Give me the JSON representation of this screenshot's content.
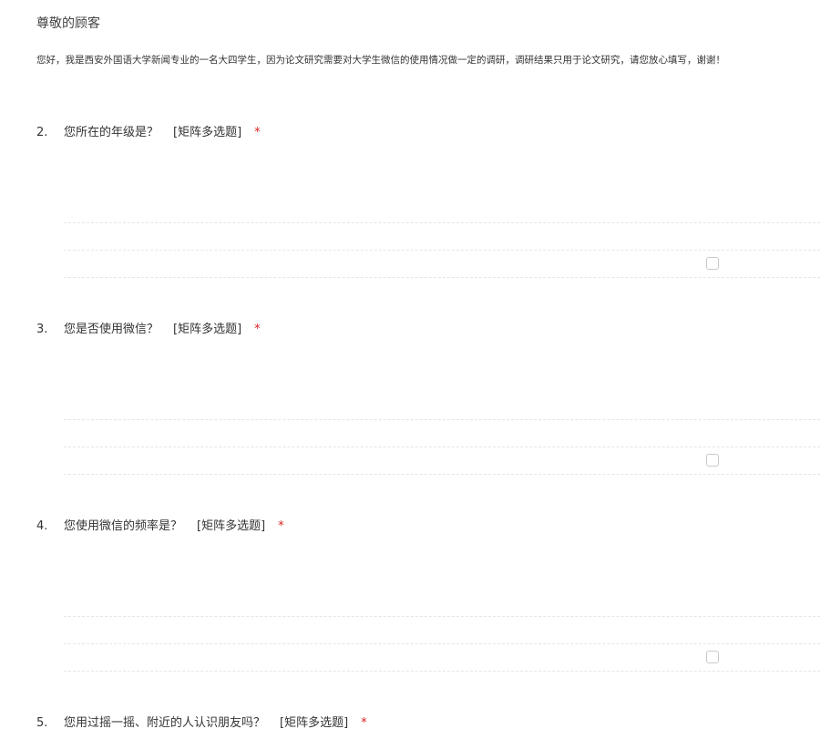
{
  "survey": {
    "heading": "尊敬的顾客",
    "intro": "您好，我是西安外国语大学新闻专业的一名大四学生，因为论文研究需要对大学生微信的使用情况做一定的调研，调研结果只用于论文研究，请您放心填写，谢谢！"
  },
  "questions": [
    {
      "number": "2.",
      "text": "您所在的年级是？",
      "type": "[矩阵多选题]",
      "required_mark": "*"
    },
    {
      "number": "3.",
      "text": "您是否使用微信？",
      "type": "[矩阵多选题]",
      "required_mark": "*"
    },
    {
      "number": "4.",
      "text": "您使用微信的频率是？",
      "type": "[矩阵多选题]",
      "required_mark": "*"
    },
    {
      "number": "5.",
      "text": "您用过摇一摇、附近的人认识朋友吗？",
      "type": "[矩阵多选题]",
      "required_mark": "*"
    }
  ],
  "colors": {
    "required": "#e02020",
    "divider": "#e6e6e6",
    "checkbox_border": "#c9c9c9"
  }
}
